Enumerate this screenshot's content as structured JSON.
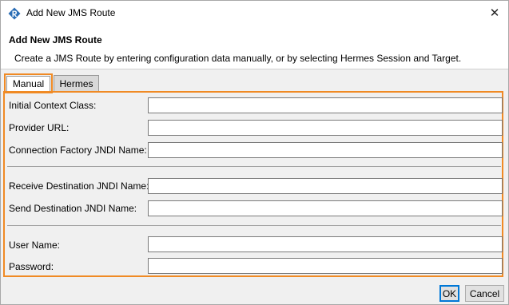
{
  "window": {
    "title": "Add New JMS Route",
    "close_glyph": "✕",
    "app_icon": "route-app-icon"
  },
  "header": {
    "title": "Add New JMS Route",
    "description": "Create a JMS Route by entering configuration data manually, or by selecting Hermes Session and Target."
  },
  "tabs": [
    {
      "label": "Manual",
      "selected": true
    },
    {
      "label": "Hermes",
      "selected": false
    }
  ],
  "form": {
    "initial_context_class": {
      "label": "Initial Context Class:",
      "value": ""
    },
    "provider_url": {
      "label": "Provider URL:",
      "value": ""
    },
    "connection_factory": {
      "label": "Connection Factory JNDI Name:",
      "value": ""
    },
    "receive_destination": {
      "label": "Receive Destination JNDI Name:",
      "value": ""
    },
    "send_destination": {
      "label": "Send Destination JNDI Name:",
      "value": ""
    },
    "user_name": {
      "label": "User Name:",
      "value": ""
    },
    "password": {
      "label": "Password:",
      "value": ""
    }
  },
  "buttons": {
    "ok": "OK",
    "cancel": "Cancel"
  },
  "colors": {
    "highlight": "#f08a24",
    "dialog_background": "#f0f0f0",
    "icon_blue": "#2a6db5"
  }
}
